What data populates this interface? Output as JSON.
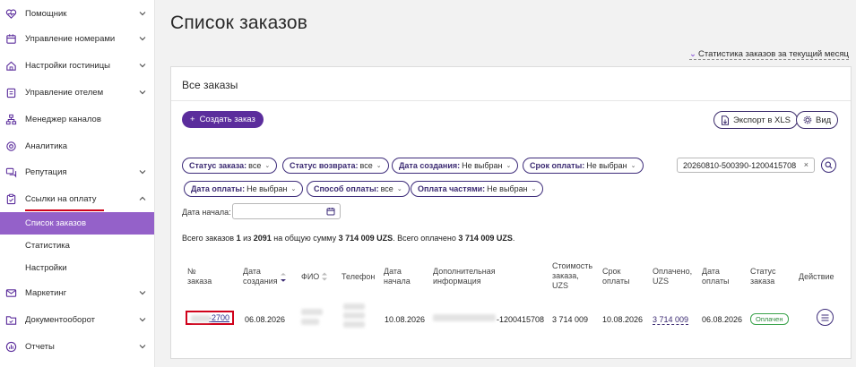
{
  "sidebar": {
    "items": [
      {
        "label": "Помощник",
        "icon": "heart-pulse-icon"
      },
      {
        "label": "Управление номерами",
        "icon": "calendar-icon"
      },
      {
        "label": "Настройки гостиницы",
        "icon": "house-icon"
      },
      {
        "label": "Управление отелем",
        "icon": "clipboard-icon"
      },
      {
        "label": "Менеджер каналов",
        "icon": "network-icon"
      },
      {
        "label": "Аналитика",
        "icon": "target-icon"
      },
      {
        "label": "Репутация",
        "icon": "chat-icon"
      },
      {
        "label": "Ссылки на оплату",
        "icon": "clipboard-check-icon"
      },
      {
        "label": "Маркетинг",
        "icon": "envelope-icon"
      },
      {
        "label": "Документооборот",
        "icon": "folder-icon"
      },
      {
        "label": "Отчеты",
        "icon": "chart-icon"
      }
    ],
    "subitems": [
      {
        "label": "Список заказов",
        "active": true
      },
      {
        "label": "Статистика",
        "active": false
      },
      {
        "label": "Настройки",
        "active": false
      }
    ]
  },
  "page": {
    "title": "Список заказов",
    "month_stats_link": "Статистика заказов за текущий месяц"
  },
  "panel": {
    "title": "Все заказы",
    "create_button": "Создать заказ",
    "export_button": "Экспорт в XLS",
    "view_button": "Вид"
  },
  "filters": [
    {
      "label": "Статус заказа:",
      "value": "все"
    },
    {
      "label": "Статус возврата:",
      "value": "все"
    },
    {
      "label": "Дата создания:",
      "value": "Не выбран"
    },
    {
      "label": "Срок оплаты:",
      "value": "Не выбран"
    },
    {
      "label": "Дата оплаты:",
      "value": "Не выбран"
    },
    {
      "label": "Способ оплаты:",
      "value": "все"
    },
    {
      "label": "Оплата частями:",
      "value": "Не выбран"
    }
  ],
  "search": {
    "value": "20260810-500390-1200415708"
  },
  "date_start": {
    "label": "Дата начала:",
    "value": ""
  },
  "summary": {
    "t1": "Всего заказов ",
    "shown": "1",
    "t2": " из ",
    "total": "2091",
    "t3": " на общую сумму ",
    "sum": "3 714 009 UZS",
    "t4": ". Всего оплачено ",
    "paid": "3 714 009 UZS",
    "t5": "."
  },
  "table": {
    "headers": [
      "№ заказа",
      "Дата создания",
      "ФИО",
      "Телефон",
      "Дата начала",
      "Дополнительная информация",
      "Стоимость заказа, UZS",
      "Срок оплаты",
      "Оплачено, UZS",
      "Дата оплаты",
      "Статус заказа",
      "Действие"
    ],
    "row": {
      "order_no": "-2700",
      "created": "06.08.2026",
      "start": "10.08.2026",
      "extra": "-1200415708",
      "cost": "3 714 009",
      "due": "10.08.2026",
      "paid": "3 714 009",
      "paid_date": "06.08.2026",
      "status": "Оплачен"
    }
  },
  "colors": {
    "accent": "#5b2d9c",
    "active_menu": "#9461c9",
    "highlight_red": "#d0021b",
    "status_green": "#3aa34b"
  }
}
